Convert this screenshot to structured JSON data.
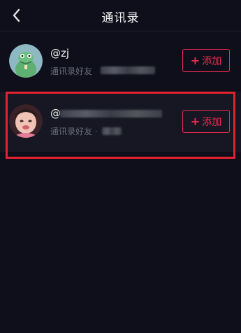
{
  "header": {
    "title": "通讯录",
    "back_icon": "chevron-left-icon"
  },
  "contacts": [
    {
      "handle": "@zj",
      "source_label": "通讯录好友",
      "add_label": "添加",
      "add_icon": "plus-icon",
      "avatar_desc": "green-cartoon-avatar"
    },
    {
      "handle": "@",
      "source_label": "通讯录好友 · ",
      "add_label": "添加",
      "add_icon": "plus-icon",
      "avatar_desc": "baby-photo-avatar"
    }
  ],
  "colors": {
    "background": "#0e0f1a",
    "accent": "#ec2b52",
    "highlight": "#e2232d",
    "secondary_text": "#6c6e7c"
  }
}
